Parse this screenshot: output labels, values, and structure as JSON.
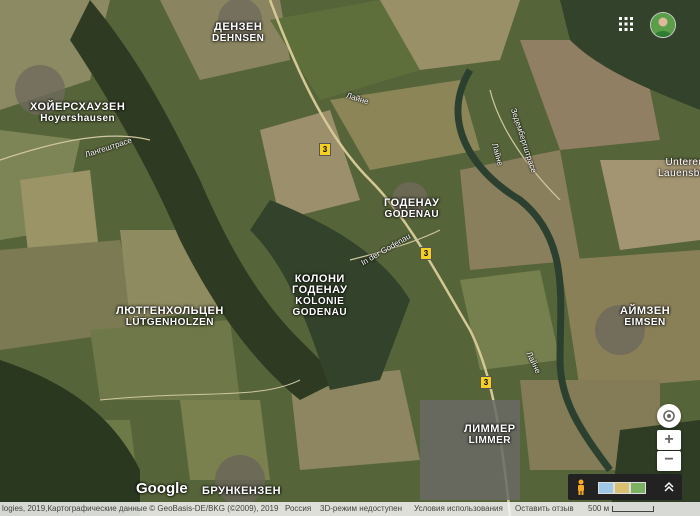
{
  "header": {
    "apps_icon": "apps-grid-icon",
    "avatar_icon": "user-avatar-icon"
  },
  "places": [
    {
      "ru": "ДЕНЗЕН",
      "lat": "DEHNSEN"
    },
    {
      "ru": "ХОЙЕРСХАУЗЕН",
      "lat": "Hoyershausen"
    },
    {
      "ru": "ГОДЕНАУ",
      "lat": "GODENAU"
    },
    {
      "ru": "КОЛОНИ",
      "lat": "ГОДЕНАУ"
    },
    {
      "ru": "ЛЮТГЕНХОЛЬЦЕН",
      "lat": "LÜTGENHOLZEN"
    },
    {
      "ru": "АЙМЗЕН",
      "lat": "EIMSEN"
    },
    {
      "ru": "ЛИММЕР",
      "lat": "LIMMER"
    },
    {
      "ru": "БРУНКЕНЗЕН",
      "lat": ""
    },
    {
      "ru": "Unterer",
      "lat": "Lauensber"
    }
  ],
  "kolonie_sub": "KOLONIE\nGODENAU",
  "streets": [
    "Лайне",
    "Лангештрасе",
    "Зедембергштрасе",
    "Лайне",
    "In der Godenau",
    "Лайне"
  ],
  "roads": [
    "3",
    "3",
    "3"
  ],
  "controls": {
    "locate_icon": "my-location-icon",
    "zoom_in": "+",
    "zoom_out": "−",
    "pegman_icon": "pegman-icon",
    "expand_icon": "chevron-up-icon"
  },
  "logo": "Google",
  "footer": {
    "attribution": "logies, 2019,Картографические данные © GeoBasis-DE/BKG (©2009), 2019",
    "country": "Россия",
    "mode3d": "3D-режим недоступен",
    "terms": "Условия использования",
    "feedback": "Оставить отзыв",
    "scale": "500 м"
  },
  "colors": {
    "field_light": "#8a8a5c",
    "field_dark": "#4a5a30",
    "forest": "#2f3e22",
    "road": "#d8d0a0"
  }
}
